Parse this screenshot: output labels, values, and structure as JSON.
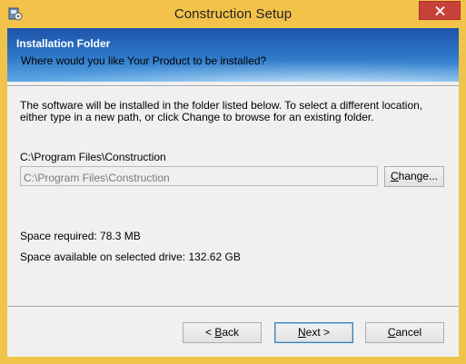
{
  "window": {
    "title": "Construction Setup"
  },
  "banner": {
    "heading": "Installation Folder",
    "subheading": "Where would you like Your Product to be installed?"
  },
  "body": {
    "description": "The software will be installed in the folder listed below. To select a different location, either type in a new path, or click Change to browse for an existing folder.",
    "path_label": "C:\\Program Files\\Construction",
    "path_value": "C:\\Program Files\\Construction",
    "space_required": "Space required: 78.3 MB",
    "space_available": "Space available on selected drive: 132.62 GB"
  },
  "buttons": {
    "change": {
      "pre": "",
      "accel": "C",
      "post": "hange..."
    },
    "back": {
      "pre": "< ",
      "accel": "B",
      "post": "ack"
    },
    "next": {
      "pre": "",
      "accel": "N",
      "post": "ext >"
    },
    "cancel": {
      "pre": "",
      "accel": "C",
      "post": "ancel"
    }
  },
  "colors": {
    "titlebar": "#f2c24a",
    "close_button": "#c7413b",
    "banner_top": "#1e53a8",
    "banner_bottom": "#5fa9e6"
  },
  "icons": [
    "installer-app-icon",
    "close-icon"
  ]
}
